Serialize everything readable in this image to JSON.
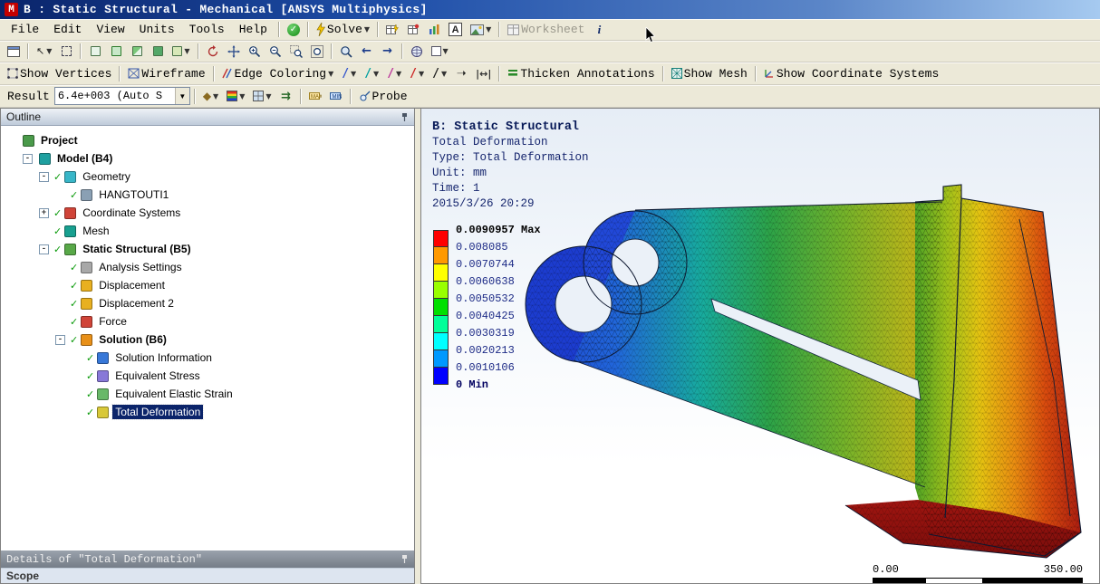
{
  "window": {
    "title": "B : Static Structural - Mechanical [ANSYS Multiphysics]",
    "app_initial": "M"
  },
  "menu_bar": {
    "items": [
      "File",
      "Edit",
      "View",
      "Units",
      "Tools",
      "Help"
    ],
    "solve": "Solve",
    "worksheet": "Worksheet",
    "annotation_letter": "A",
    "info_letter": "i"
  },
  "display_toolbar": {
    "show_vertices": "Show Vertices",
    "wireframe": "Wireframe",
    "edge_coloring": "Edge Coloring",
    "thicken_annotations": "Thicken Annotations",
    "show_mesh": "Show Mesh",
    "show_coordinate_systems": "Show Coordinate Systems"
  },
  "result_toolbar": {
    "label": "Result",
    "scale_value": "6.4e+003 (Auto S",
    "probe": "Probe"
  },
  "outline": {
    "header": "Outline",
    "items": [
      {
        "label": "Project",
        "level": 0,
        "expand": null,
        "icon": "project",
        "icon_color": "#4a9a4a",
        "check": false,
        "bold": true,
        "selected": false
      },
      {
        "label": "Model (B4)",
        "level": 1,
        "expand": "minus",
        "icon": "model",
        "icon_color": "#1fa0a0",
        "check": false,
        "bold": true,
        "selected": false
      },
      {
        "label": "Geometry",
        "level": 2,
        "expand": "minus",
        "icon": "geometry",
        "icon_color": "#38b6c8",
        "check": true,
        "bold": false,
        "selected": false
      },
      {
        "label": "HANGTOUTI1",
        "level": 3,
        "expand": null,
        "icon": "part",
        "icon_color": "#8aa0b4",
        "check": true,
        "bold": false,
        "selected": false
      },
      {
        "label": "Coordinate Systems",
        "level": 2,
        "expand": "plus",
        "icon": "coordinate-systems",
        "icon_color": "#d04438",
        "check": true,
        "bold": false,
        "selected": false
      },
      {
        "label": "Mesh",
        "level": 2,
        "expand": null,
        "icon": "mesh",
        "icon_color": "#18a090",
        "check": true,
        "bold": false,
        "selected": false
      },
      {
        "label": "Static Structural (B5)",
        "level": 2,
        "expand": "minus",
        "icon": "environment",
        "icon_color": "#58a848",
        "check": true,
        "bold": true,
        "selected": false
      },
      {
        "label": "Analysis Settings",
        "level": 3,
        "expand": null,
        "icon": "analysis-settings",
        "icon_color": "#a8a8a8",
        "check": true,
        "bold": false,
        "selected": false
      },
      {
        "label": "Displacement",
        "level": 3,
        "expand": null,
        "icon": "displacement",
        "icon_color": "#e8b020",
        "check": true,
        "bold": false,
        "selected": false
      },
      {
        "label": "Displacement 2",
        "level": 3,
        "expand": null,
        "icon": "displacement",
        "icon_color": "#e8b020",
        "check": true,
        "bold": false,
        "selected": false
      },
      {
        "label": "Force",
        "level": 3,
        "expand": null,
        "icon": "force",
        "icon_color": "#d04438",
        "check": true,
        "bold": false,
        "selected": false
      },
      {
        "label": "Solution (B6)",
        "level": 3,
        "expand": "minus",
        "icon": "solution",
        "icon_color": "#e89018",
        "check": true,
        "bold": true,
        "selected": false
      },
      {
        "label": "Solution Information",
        "level": 4,
        "expand": null,
        "icon": "solution-information",
        "icon_color": "#3878d8",
        "check": true,
        "bold": false,
        "selected": false
      },
      {
        "label": "Equivalent Stress",
        "level": 4,
        "expand": null,
        "icon": "result-stress",
        "icon_color": "#8878d8",
        "check": true,
        "bold": false,
        "selected": false
      },
      {
        "label": "Equivalent Elastic Strain",
        "level": 4,
        "expand": null,
        "icon": "result-strain",
        "icon_color": "#68b868",
        "check": true,
        "bold": false,
        "selected": false
      },
      {
        "label": "Total Deformation",
        "level": 4,
        "expand": null,
        "icon": "result-deformation",
        "icon_color": "#d8c838",
        "check": true,
        "bold": false,
        "selected": true
      }
    ]
  },
  "details": {
    "header": "Details of \"Total Deformation\"",
    "first_row": "Scope"
  },
  "viewport": {
    "annotation": [
      "B: Static Structural",
      "Total Deformation",
      "Type: Total Deformation",
      "Unit: mm",
      "Time: 1",
      "2015/3/26 20:29"
    ],
    "legend": {
      "labels": [
        "0.0090957 Max",
        "0.008085",
        "0.0070744",
        "0.0060638",
        "0.0050532",
        "0.0040425",
        "0.0030319",
        "0.0020213",
        "0.0010106",
        "0 Min"
      ],
      "colors": [
        "#ff0000",
        "#ff9900",
        "#ffff00",
        "#99ff00",
        "#00e000",
        "#00ff99",
        "#00ffff",
        "#0099ff",
        "#0000ff"
      ]
    },
    "ruler": {
      "left": "0.00",
      "right": "350.00"
    }
  }
}
